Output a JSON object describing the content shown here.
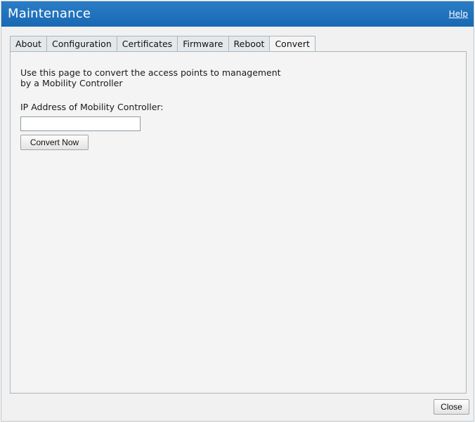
{
  "window": {
    "title": "Maintenance",
    "help_link": "Help"
  },
  "tabs": [
    {
      "label": "About",
      "active": false
    },
    {
      "label": "Configuration",
      "active": false
    },
    {
      "label": "Certificates",
      "active": false
    },
    {
      "label": "Firmware",
      "active": false
    },
    {
      "label": "Reboot",
      "active": false
    },
    {
      "label": "Convert",
      "active": true
    }
  ],
  "convert": {
    "description_line1": "Use this page to convert the access points to management",
    "description_line2": "by a Mobility Controller",
    "ip_label": "IP Address of Mobility Controller:",
    "ip_value": "",
    "ip_placeholder": "",
    "convert_button": "Convert Now"
  },
  "footer": {
    "close_button": "Close"
  },
  "colors": {
    "titlebar": "#1868b3",
    "panel_background": "#f4f4f4",
    "tab_border": "#a9b6c0"
  }
}
